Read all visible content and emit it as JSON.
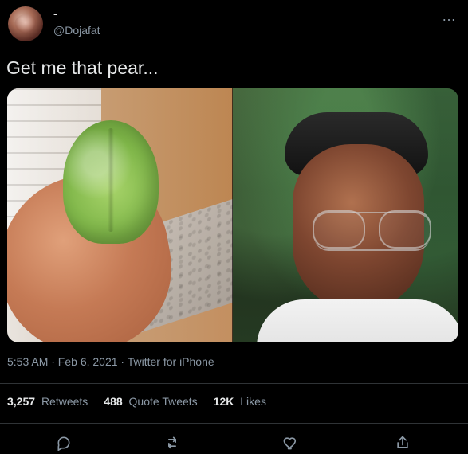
{
  "tweet": {
    "display_name": "-",
    "handle": "@Dojafat",
    "text": "Get me that pear...",
    "timestamp": "5:53 AM · Feb 6, 2021 · Twitter for iPhone"
  },
  "stats": {
    "retweets_count": "3,257",
    "retweets_label": "Retweets",
    "quote_tweets_count": "488",
    "quote_tweets_label": "Quote Tweets",
    "likes_count": "12K",
    "likes_label": "Likes"
  },
  "icons": {
    "more": "more-icon",
    "reply": "reply-icon",
    "retweet": "retweet-icon",
    "like": "heart-icon",
    "share": "share-icon"
  },
  "colors": {
    "background": "#000000",
    "text_primary": "#e7e9ea",
    "text_secondary": "#8b98a5",
    "divider": "#2f3336"
  }
}
